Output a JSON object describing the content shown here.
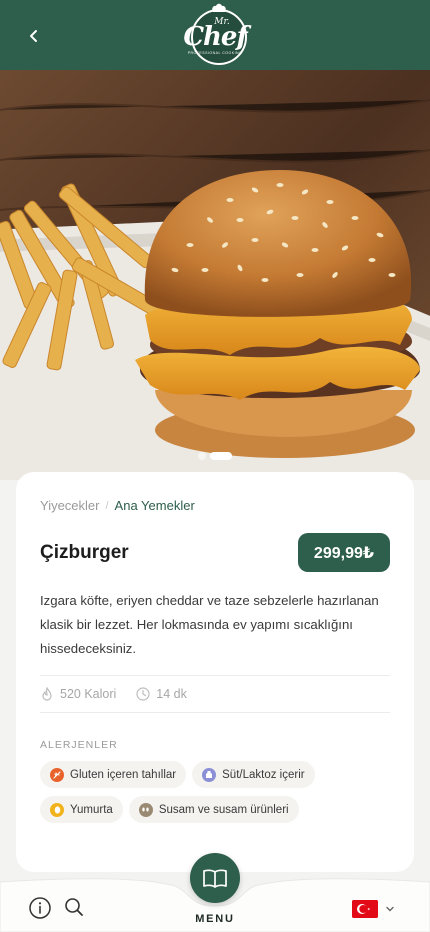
{
  "header": {
    "back_icon": "chevron-left-icon",
    "logo_mr": "Mr.",
    "logo_word": "Chef",
    "logo_sub": "PROFESSIONAL COOKING"
  },
  "gallery": {
    "image": "cheeseburger-with-fries-photo",
    "count": 2,
    "active_index": 1
  },
  "breadcrumb": {
    "category": "Yiyecekler",
    "subcategory": "Ana Yemekler"
  },
  "product": {
    "name": "Çizburger",
    "price": "299,99₺",
    "description": "Izgara köfte, eriyen cheddar ve taze sebzelerle hazırlanan klasik bir lezzet. Her lokmasında ev yapımı sıcaklığını hissedeceksiniz.",
    "calories": "520 Kalori",
    "prep_time": "14 dk"
  },
  "allergens": {
    "title": "ALERJENLER",
    "items": [
      {
        "label": "Gluten içeren tahıllar",
        "icon": "wheat-icon",
        "color": "#e8632b"
      },
      {
        "label": "Süt/Laktoz içerir",
        "icon": "milk-icon",
        "color": "#8a8fd6"
      },
      {
        "label": "Yumurta",
        "icon": "egg-icon",
        "color": "#f2b21b"
      },
      {
        "label": "Susam ve susam ürünleri",
        "icon": "sesame-icon",
        "color": "#9b8a73"
      }
    ]
  },
  "bottom_nav": {
    "menu_label": "MENU",
    "info_icon": "info-icon",
    "search_icon": "search-icon",
    "menu_icon": "book-icon",
    "language": "tr-flag-icon"
  },
  "colors": {
    "primary": "#2e5e4c",
    "background": "#f3f3f1"
  }
}
